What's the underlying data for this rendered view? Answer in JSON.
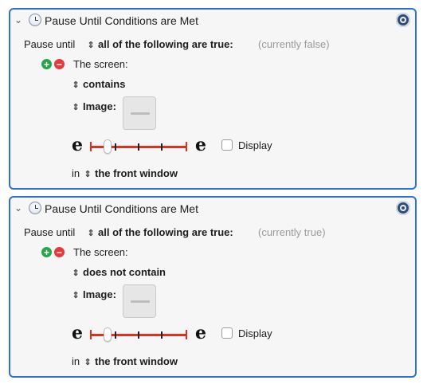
{
  "actions": [
    {
      "title": "Pause Until Conditions are Met",
      "pause_until_label": "Pause until",
      "condition_mode": "all of the following are true:",
      "status": "(currently false)",
      "screen_label": "The screen:",
      "match_mode": "contains",
      "image_label": "Image:",
      "display_label": "Display",
      "display_checked": false,
      "fuzz_left_glyph": "e",
      "fuzz_right_glyph": "e",
      "fuzz_level": 0.15,
      "in_label": "in",
      "scope": "the front window"
    },
    {
      "title": "Pause Until Conditions are Met",
      "pause_until_label": "Pause until",
      "condition_mode": "all of the following are true:",
      "status": "(currently true)",
      "screen_label": "The screen:",
      "match_mode": "does not contain",
      "image_label": "Image:",
      "display_label": "Display",
      "display_checked": false,
      "fuzz_left_glyph": "e",
      "fuzz_right_glyph": "e",
      "fuzz_level": 0.15,
      "in_label": "in",
      "scope": "the front window"
    }
  ],
  "glyphs": {
    "disclosure": "⌄",
    "updown": "⇕",
    "plus": "+",
    "minus": "−"
  },
  "colors": {
    "selection_border": "#2f6fd6",
    "slider_red": "#e0301e",
    "plus_green": "#2aa44a",
    "minus_red": "#e23b3b"
  },
  "icons": {
    "action_icon": "clock-icon",
    "settings_icon": "gear-icon"
  }
}
